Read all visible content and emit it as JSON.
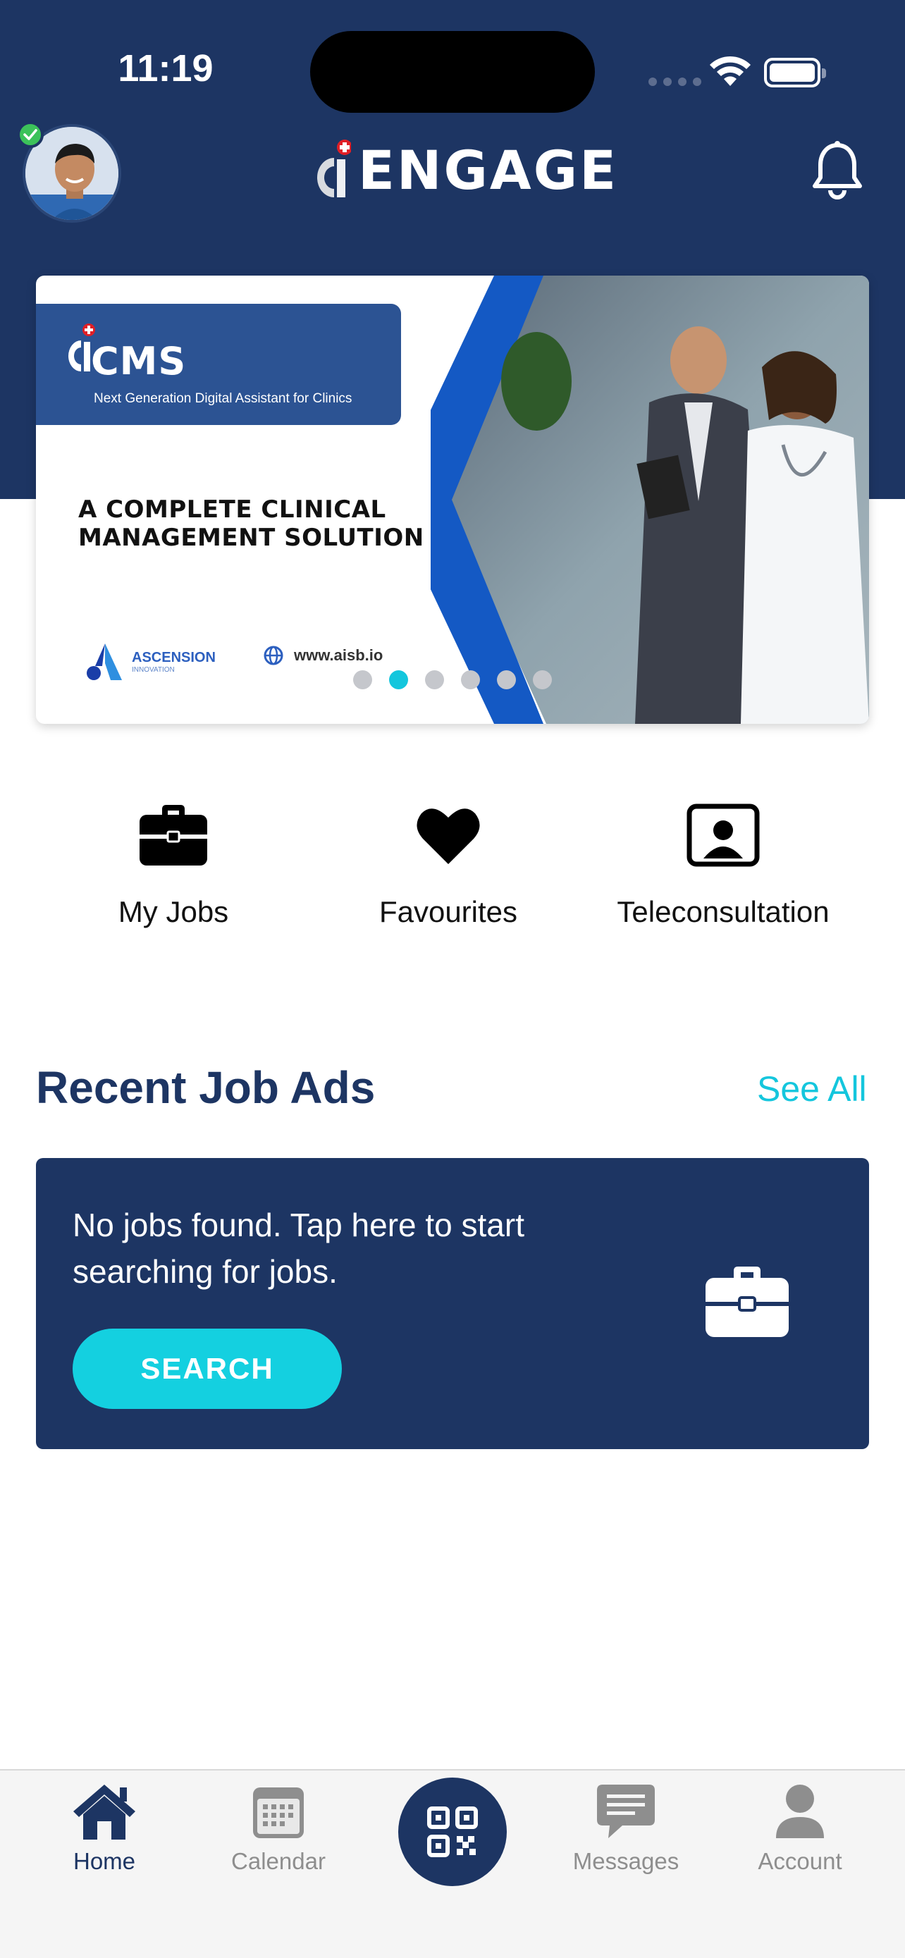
{
  "status_bar": {
    "time": "11:19"
  },
  "header": {
    "logo_text": "ENGAGE"
  },
  "banner": {
    "product_name": "CMS",
    "tagline": "Next Generation Digital Assistant for Clinics",
    "headline_line1": "A COMPLETE CLINICAL",
    "headline_line2": "MANAGEMENT SOLUTION",
    "company_name": "ASCENSION",
    "company_sub": "INNOVATION",
    "website": "www.aisb.io",
    "slide_count": 6,
    "active_slide": 2
  },
  "quick_actions": [
    {
      "label": "My Jobs",
      "icon": "briefcase-icon"
    },
    {
      "label": "Favourites",
      "icon": "heart-icon"
    },
    {
      "label": "Teleconsultation",
      "icon": "contact-card-icon"
    }
  ],
  "recent_jobs": {
    "title": "Recent Job Ads",
    "see_all": "See All",
    "empty_message": "No jobs found. Tap here to start searching for jobs.",
    "search_label": "SEARCH"
  },
  "tabbar": {
    "items": [
      {
        "label": "Home",
        "icon": "home-icon",
        "active": true
      },
      {
        "label": "Calendar",
        "icon": "calendar-icon",
        "active": false
      },
      {
        "label": "",
        "icon": "qr-code-icon",
        "active": false
      },
      {
        "label": "Messages",
        "icon": "messages-icon",
        "active": false
      },
      {
        "label": "Account",
        "icon": "account-icon",
        "active": false
      }
    ]
  },
  "colors": {
    "primary": "#1d3563",
    "accent": "#14c6dd",
    "inactive_tab": "#8e8e8e",
    "online": "#3cc25a"
  }
}
